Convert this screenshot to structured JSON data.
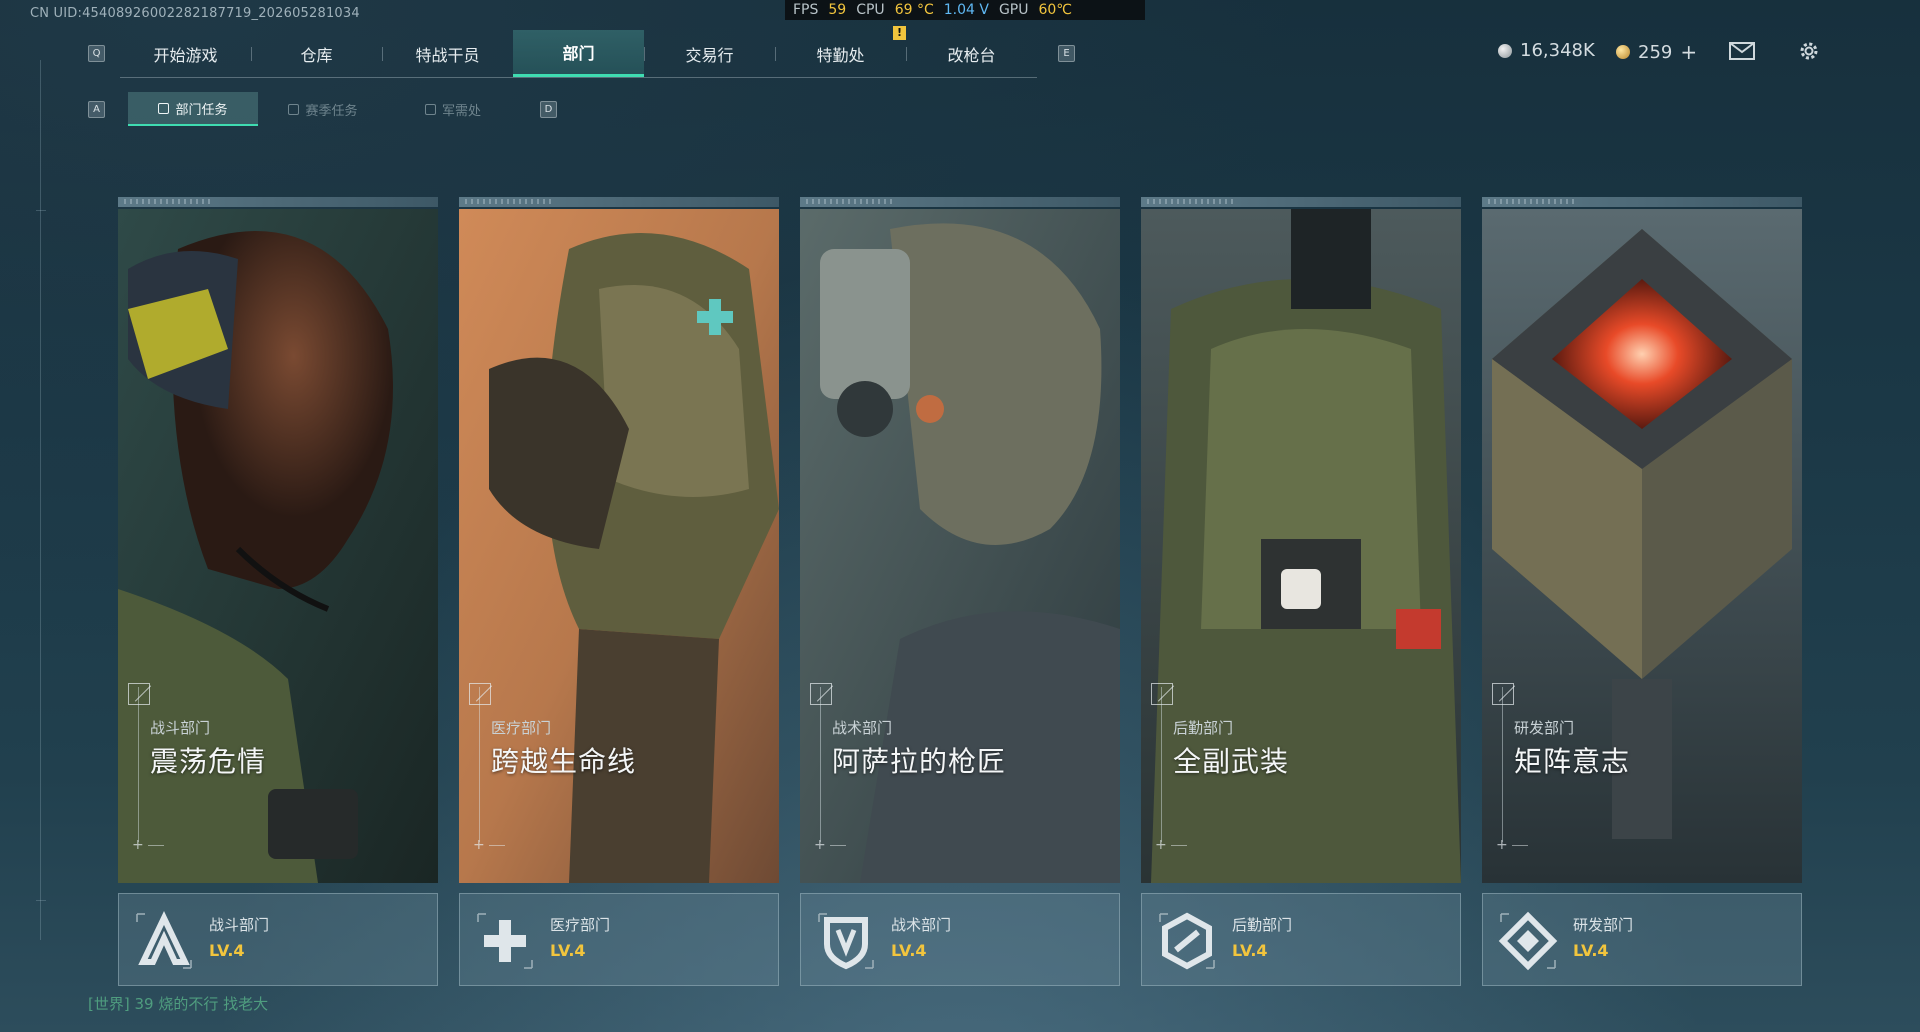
{
  "uid": "CN UID:4540892600228218771​9_202605281034",
  "perf": {
    "fps_label": "FPS",
    "fps_value": "59",
    "cpu_label": "CPU",
    "cpu_temp": "69 °C",
    "cpu_volt": "1.04 V",
    "gpu_label": "GPU",
    "gpu_temp": "60℃",
    "marker": "!"
  },
  "keys": {
    "q": "Q",
    "e": "E",
    "a": "A",
    "d": "D"
  },
  "topnav": {
    "tabs": [
      {
        "label": "开始游戏"
      },
      {
        "label": "仓库"
      },
      {
        "label": "特战干员"
      },
      {
        "label": "部门"
      },
      {
        "label": "交易行"
      },
      {
        "label": "特勤处"
      },
      {
        "label": "改枪台"
      }
    ],
    "active_index": 3
  },
  "currency": {
    "silver": "16,348K",
    "gold": "259",
    "plus": "+"
  },
  "subnav": {
    "tabs": [
      {
        "label": "部门任务"
      },
      {
        "label": "赛季任务"
      },
      {
        "label": "军需处"
      }
    ]
  },
  "cards": [
    {
      "dept": "战斗部门",
      "title": "震荡危情"
    },
    {
      "dept": "医疗部门",
      "title": "跨越生命线"
    },
    {
      "dept": "战术部门",
      "title": "阿萨拉的枪匠"
    },
    {
      "dept": "后勤部门",
      "title": "全副武装"
    },
    {
      "dept": "研发部门",
      "title": "矩阵意志"
    }
  ],
  "plates": [
    {
      "name": "战斗部门",
      "level": "LV.4"
    },
    {
      "name": "医疗部门",
      "level": "LV.4"
    },
    {
      "name": "战术部门",
      "level": "LV.4"
    },
    {
      "name": "后勤部门",
      "level": "LV.4"
    },
    {
      "name": "研发部门",
      "level": "LV.4"
    }
  ],
  "chat": {
    "channel": "[世界]",
    "sender": "39",
    "message": "烧的不行 找老大"
  },
  "colors": {
    "accent": "#3fdcb1",
    "level": "#f2c53d"
  }
}
